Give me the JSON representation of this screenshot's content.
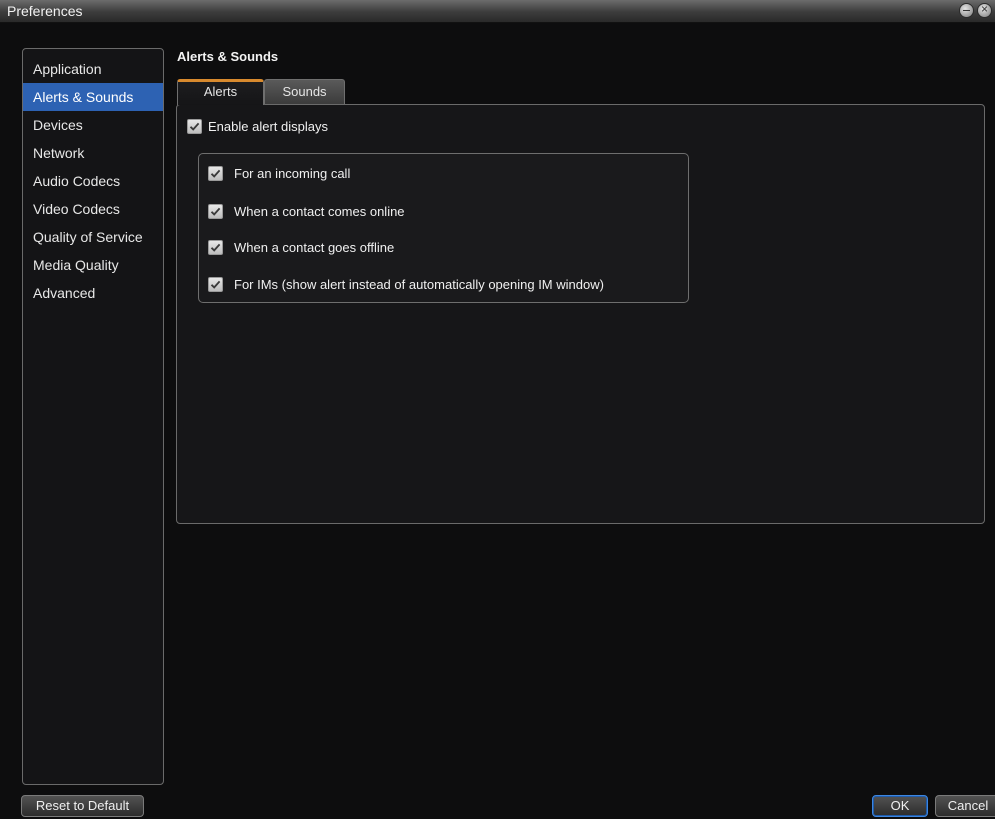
{
  "window": {
    "title": "Preferences"
  },
  "sidebar": {
    "items": [
      {
        "label": "Application"
      },
      {
        "label": "Alerts & Sounds",
        "selected": true
      },
      {
        "label": "Devices"
      },
      {
        "label": "Network"
      },
      {
        "label": "Audio Codecs"
      },
      {
        "label": "Video Codecs"
      },
      {
        "label": "Quality of Service"
      },
      {
        "label": "Media Quality"
      },
      {
        "label": "Advanced"
      }
    ]
  },
  "main": {
    "section_title": "Alerts & Sounds",
    "tabs": [
      {
        "label": "Alerts",
        "active": true
      },
      {
        "label": "Sounds",
        "active": false
      }
    ],
    "enable_alerts": {
      "label": "Enable alert displays",
      "checked": true
    },
    "alert_options": [
      {
        "label": "For an incoming call",
        "checked": true
      },
      {
        "label": "When a contact comes online",
        "checked": true
      },
      {
        "label": "When a contact goes offline",
        "checked": true
      },
      {
        "label": "For IMs (show alert instead of automatically opening IM window)",
        "checked": true
      }
    ]
  },
  "footer": {
    "reset_label": "Reset to Default",
    "ok_label": "OK",
    "cancel_label": "Cancel"
  },
  "colors": {
    "selection": "#2d62b3",
    "tab_accent": "#d88a2e",
    "ok_border": "#3d86e0"
  }
}
